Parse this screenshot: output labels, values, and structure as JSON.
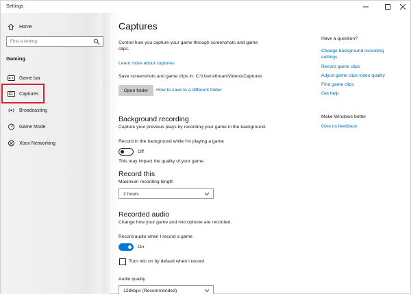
{
  "window": {
    "title": "Settings"
  },
  "sidebar": {
    "home_label": "Home",
    "search_placeholder": "Find a setting",
    "section_label": "Gaming",
    "items": [
      {
        "label": "Game bar",
        "icon": "game-bar-icon"
      },
      {
        "label": "Captures",
        "icon": "captures-icon",
        "selected": true
      },
      {
        "label": "Broadcasting",
        "icon": "broadcast-icon"
      },
      {
        "label": "Game Mode",
        "icon": "game-mode-icon"
      },
      {
        "label": "Xbox Networking",
        "icon": "xbox-icon"
      }
    ]
  },
  "main": {
    "title": "Captures",
    "intro_line1": "Control how you capture your game through screenshots and game",
    "intro_line2": "clips.",
    "learn_more": "Learn more about captures",
    "save_path": "Save screenshots and game clips in: C:\\Users\\thuan\\Videos\\Captures",
    "open_folder": "Open folder",
    "different_folder": "How to save to a different folder",
    "background": {
      "heading": "Background recording",
      "desc": "Capture your previous plays by recording your game in the background.",
      "toggle_label": "Record in the background while I'm playing a game",
      "toggle_state": "Off",
      "note": "This may impact the quality of your game."
    },
    "record_this": {
      "heading": "Record this",
      "label": "Maximum recording length",
      "value": "2 hours"
    },
    "audio": {
      "heading": "Recorded audio",
      "desc": "Change how your game and microphone are recorded.",
      "toggle_label": "Record audio when I record a game",
      "toggle_state": "On",
      "mic_label": "Turn mic on by default when I record",
      "quality_label": "Audio quality",
      "quality_value": "128kbps (Recommended)"
    }
  },
  "help": {
    "heading": "Have a question?",
    "links": [
      "Change background recording",
      "settings",
      "Record game clips",
      "Adjust game clips video quality",
      "Find game clips",
      "Get help"
    ],
    "better_heading": "Make Windows better",
    "feedback": "Give us feedback"
  },
  "colors": {
    "accent": "#0078d7",
    "link": "#0067b8",
    "highlight": "#d6232f"
  }
}
